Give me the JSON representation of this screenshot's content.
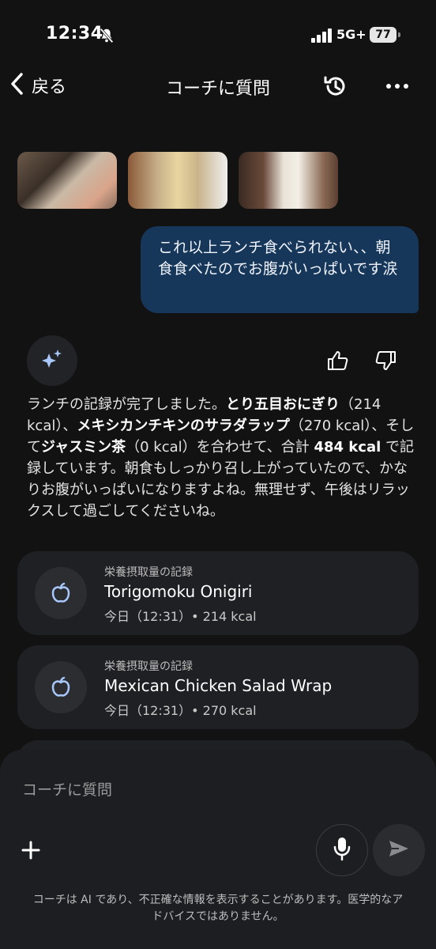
{
  "status_bar": {
    "time": "12:34",
    "network": "5G+",
    "battery": "77"
  },
  "header": {
    "back_label": "戻る",
    "title": "コーチに質問"
  },
  "user_message": {
    "text": "これ以上ランチ食べられない、、朝食食べたのでお腹がいっぱいです涙"
  },
  "assistant_message": {
    "segments": [
      {
        "text": "ランチの記録が完了しました。",
        "bold": false
      },
      {
        "text": "とり五目おにぎり",
        "bold": true
      },
      {
        "text": "（214 kcal）、",
        "bold": false
      },
      {
        "text": "メキシカンチキンのサラダラップ",
        "bold": true
      },
      {
        "text": "（270 kcal）、そして",
        "bold": false
      },
      {
        "text": "ジャスミン茶",
        "bold": true
      },
      {
        "text": "（0 kcal）を合わせて、合計 ",
        "bold": false
      },
      {
        "text": "484 kcal",
        "bold": true
      },
      {
        "text": " で記録しています。朝食もしっかり召し上がっていたので、かなりお腹がいっぱいになりますよね。無理せず、午後はリラックスして過ごしてくださいね。",
        "bold": false
      }
    ]
  },
  "log_cards": [
    {
      "label": "栄養摂取量の記録",
      "name": "Torigomoku Onigiri",
      "meta": "今日（12:31）• 214 kcal"
    },
    {
      "label": "栄養摂取量の記録",
      "name": "Mexican Chicken Salad Wrap",
      "meta": "今日（12:31）• 270 kcal"
    }
  ],
  "composer": {
    "placeholder": "コーチに質問",
    "disclaimer": "コーチは AI であり、不正確な情報を表示することがあります。医学的なアドバイスではありません。"
  },
  "colors": {
    "background": "#121212",
    "user_bubble": "#16365a",
    "card": "#1f2023",
    "icon_accent": "#a8c7fa"
  }
}
